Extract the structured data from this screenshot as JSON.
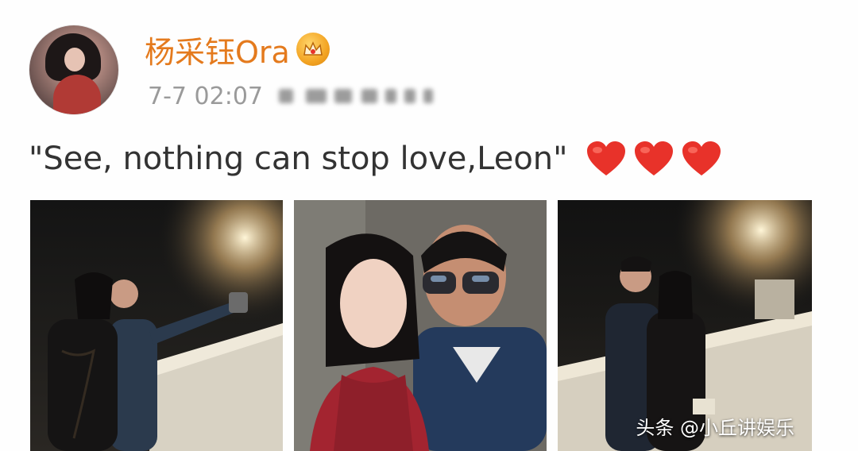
{
  "post": {
    "username": "杨采钰Ora",
    "timestamp": "7-7 02:07",
    "text": "\"See, nothing can stop love,Leon\"",
    "heart_count": 3
  },
  "watermark": {
    "text": "头条 @小丘讲娱乐"
  },
  "colors": {
    "username": "#e47a1d",
    "timestamp": "#9a9a9a",
    "heart": "#e8322a",
    "badge": "#f3a423"
  },
  "icons": {
    "vip_badge": "crown-badge-icon",
    "heart": "heart-icon"
  }
}
